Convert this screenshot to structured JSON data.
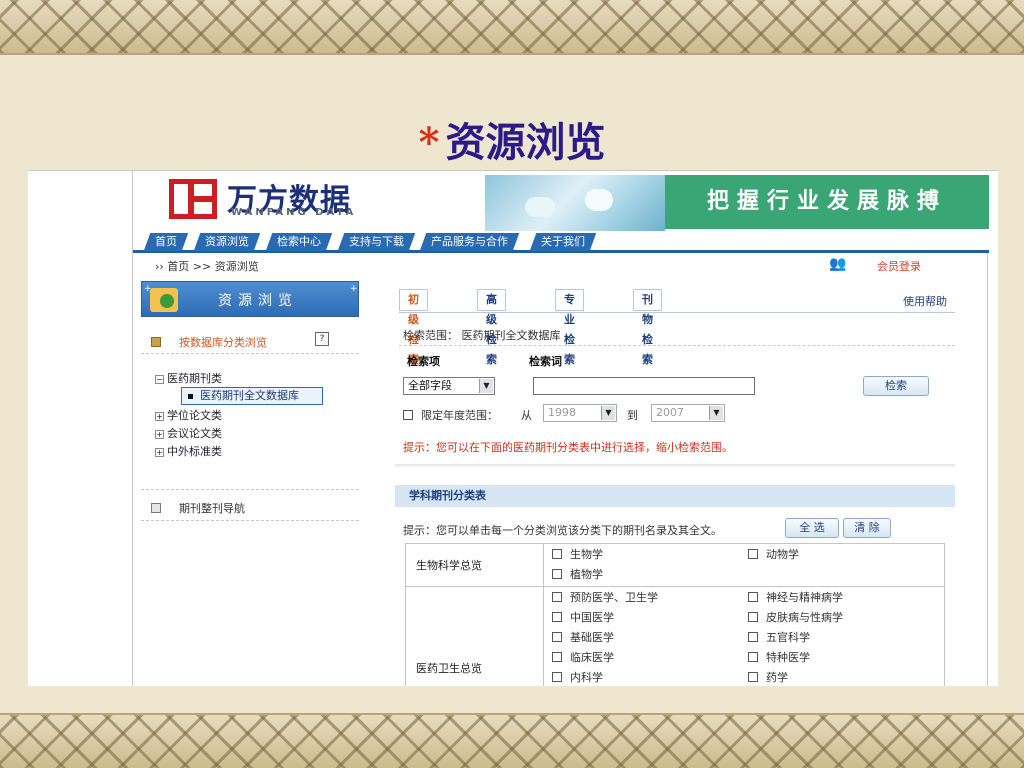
{
  "slide": {
    "star": "*",
    "title": "资源浏览"
  },
  "header": {
    "logo_cn": "万方数据",
    "logo_en": "WANFANG DATA",
    "slogan": "把握行业发展脉搏"
  },
  "nav": {
    "items": [
      "首页",
      "资源浏览",
      "检索中心",
      "支持与下载",
      "产品服务与合作",
      "关于我们"
    ]
  },
  "breadcrumb": "›› 首页 >> 资源浏览",
  "member_login": "会员登录",
  "sidebar": {
    "title": "资源浏览",
    "by_database": "按数据库分类浏览",
    "help": "?",
    "tree": [
      {
        "label": "医药期刊类",
        "toggle": "−"
      },
      {
        "label": "学位论文类",
        "toggle": "+"
      },
      {
        "label": "会议论文类",
        "toggle": "+"
      },
      {
        "label": "中外标准类",
        "toggle": "+"
      }
    ],
    "selected_child": "医药期刊全文数据库",
    "journal_nav": "期刊整刊导航"
  },
  "search": {
    "tabs": [
      "初级检索",
      "高级检索",
      "专业检索",
      "刊物检索"
    ],
    "help_link": "使用帮助",
    "scope_label": "检索范围：",
    "scope_value": "医药期刊全文数据库",
    "field_header": "检索项",
    "term_header": "检索词",
    "field_value": "全部字段",
    "search_button": "检索",
    "year_limit_label": "限定年度范围：",
    "from_label": "从",
    "from_year": "1998",
    "to_label": "到",
    "to_year": "2007",
    "hint": "提示：您可以在下面的医药期刊分类表中进行选择，缩小检索范围。"
  },
  "classification": {
    "title": "学科期刊分类表",
    "hint": "提示：您可以单击每一个分类浏览该分类下的期刊名录及其全文。",
    "select_all": "全 选",
    "clear": "清 除",
    "groups": [
      {
        "name": "生物科学总览",
        "items": [
          "生物学",
          "动物学",
          "植物学"
        ]
      },
      {
        "name": "医药卫生总览",
        "items": [
          "预防医学、卫生学",
          "神经与精神病学",
          "中国医学",
          "皮肤病与性病学",
          "基础医学",
          "五官科学",
          "临床医学",
          "特种医学",
          "内科学",
          "药学"
        ]
      }
    ]
  }
}
